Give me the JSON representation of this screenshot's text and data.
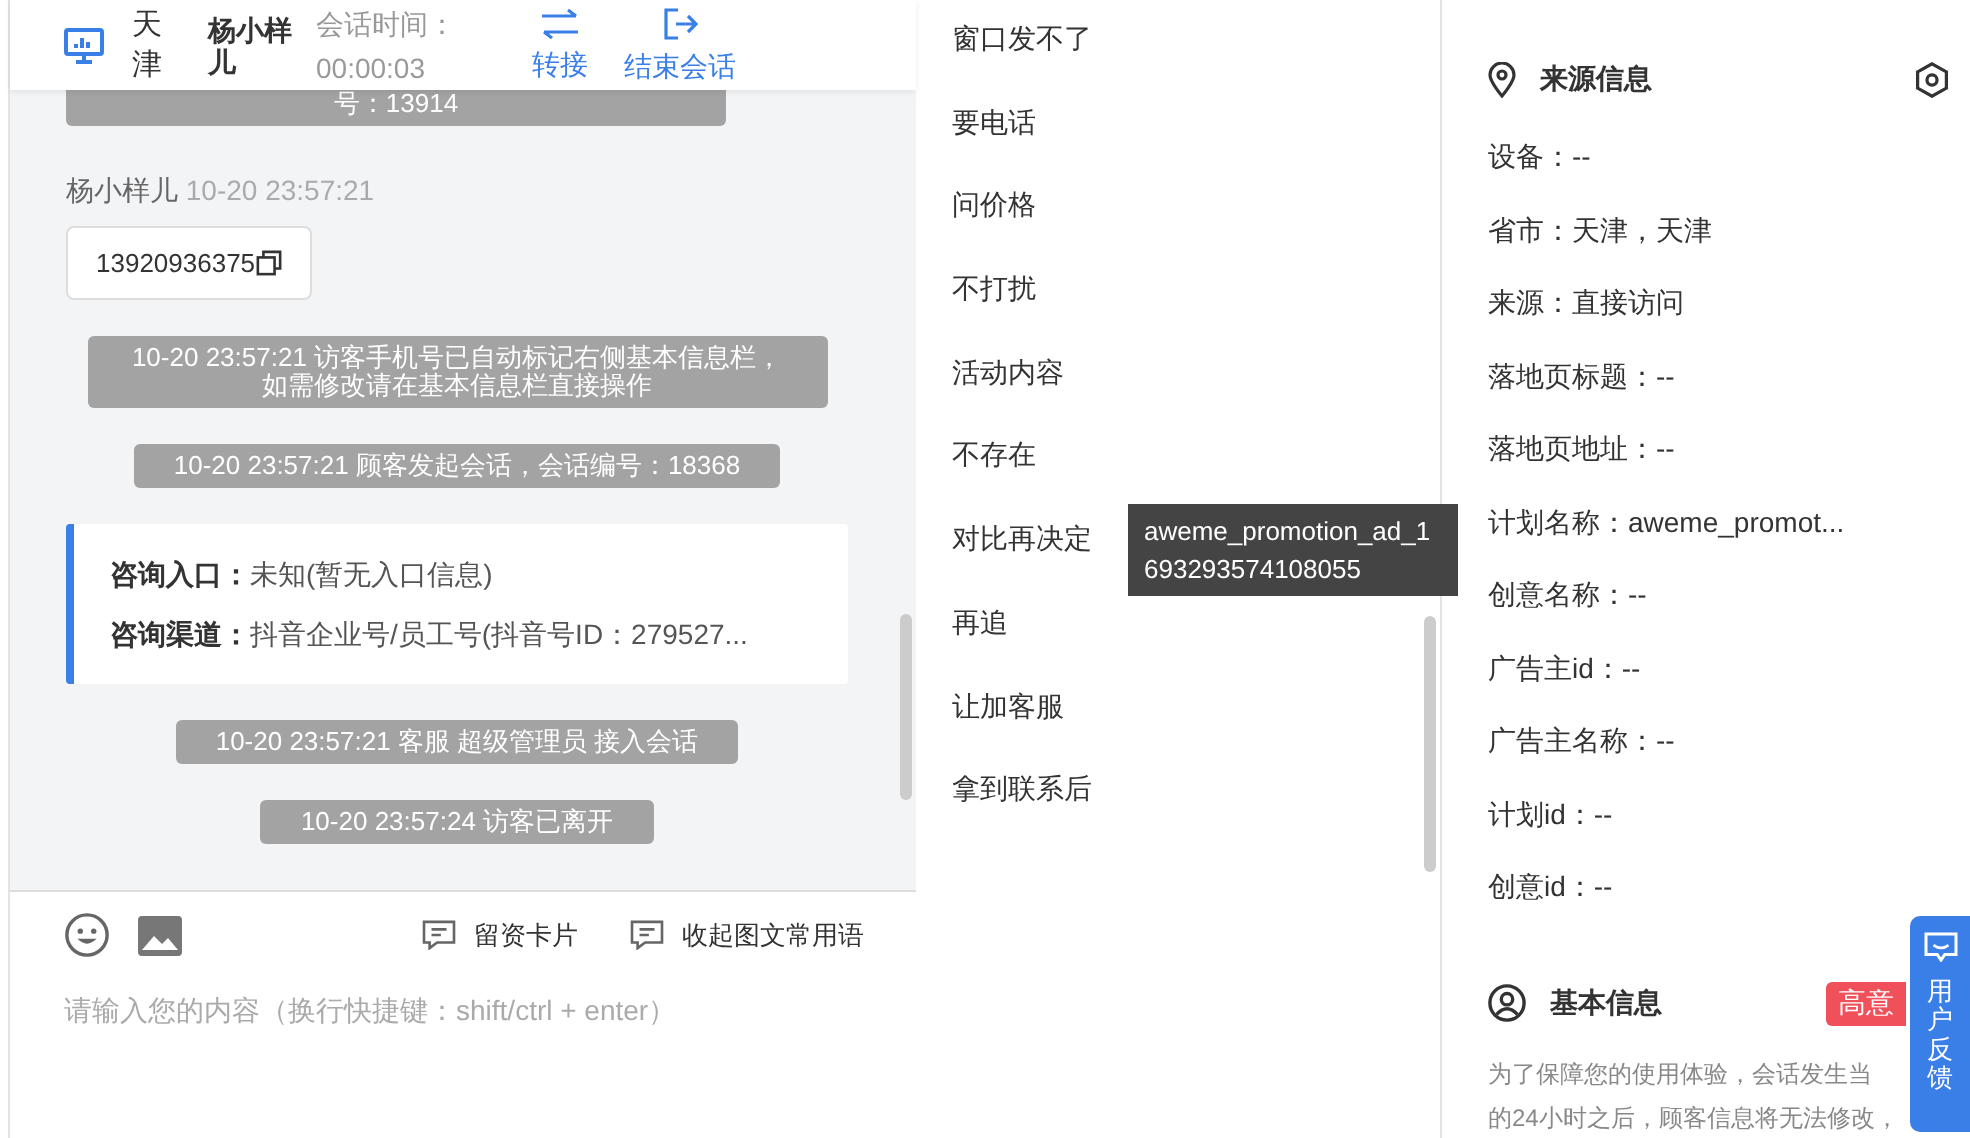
{
  "header": {
    "city": "天津",
    "visitor_name": "杨小样儿",
    "timer_label": "会话时间：",
    "timer_value": "00:00:03",
    "actions": [
      {
        "kind": "transfer",
        "label": "转接"
      },
      {
        "kind": "end",
        "label": "结束会话"
      }
    ]
  },
  "messages": [
    {
      "kind": "system",
      "text": "号：13914"
    },
    {
      "kind": "visitor",
      "sender": "杨小样儿",
      "time": "10-20 23:57:21",
      "text": "13920936375"
    },
    {
      "kind": "system",
      "text": "10-20 23:57:21 访客手机号已自动标记右侧基本信息栏，如需修改请在基本信息栏直接操作"
    },
    {
      "kind": "system",
      "text": "10-20 23:57:21 顾客发起会话，会话编号：18368"
    },
    {
      "kind": "info",
      "lines": [
        {
          "label": "咨询入口：",
          "value": "未知(暂无入口信息)"
        },
        {
          "label": "咨询渠道：",
          "value": "抖音企业号/员工号(抖音号ID：279527..."
        }
      ]
    },
    {
      "kind": "system",
      "text": "10-20 23:57:21 客服 超级管理员 接入会话"
    },
    {
      "kind": "system",
      "text": "10-20 23:57:24 访客已离开"
    }
  ],
  "composer": {
    "placeholder": "请输入您的内容（换行快捷键：shift/ctrl + enter）",
    "tools": [
      {
        "label": "留资卡片"
      },
      {
        "label": "收起图文常用语"
      }
    ]
  },
  "quick_phrases": [
    "窗口发不了",
    "要电话",
    "问价格",
    "不打扰",
    "活动内容",
    "不存在",
    "对比再决定",
    "再追",
    "让加客服",
    "拿到联系后"
  ],
  "source_info": {
    "title": "来源信息",
    "fields": [
      "设备：--",
      "省市：天津，天津",
      "来源：直接访问",
      "落地页标题：--",
      "落地页地址：--",
      "计划名称：aweme_promot...",
      "创意名称：--",
      "广告主id：--",
      "广告主名称：--",
      "计划id：--",
      "创意id：--"
    ],
    "tooltip": {
      "text": "aweme_promotion_ad_1693293574108055"
    }
  },
  "basic_info": {
    "title": "基本信息",
    "tag": "高意",
    "notice_lines": [
      "为了保障您的使用体验，会话发生当",
      "的24小时之后，顾客信息将无法修改，"
    ]
  },
  "feedback_button": {
    "label": "用户反馈"
  }
}
